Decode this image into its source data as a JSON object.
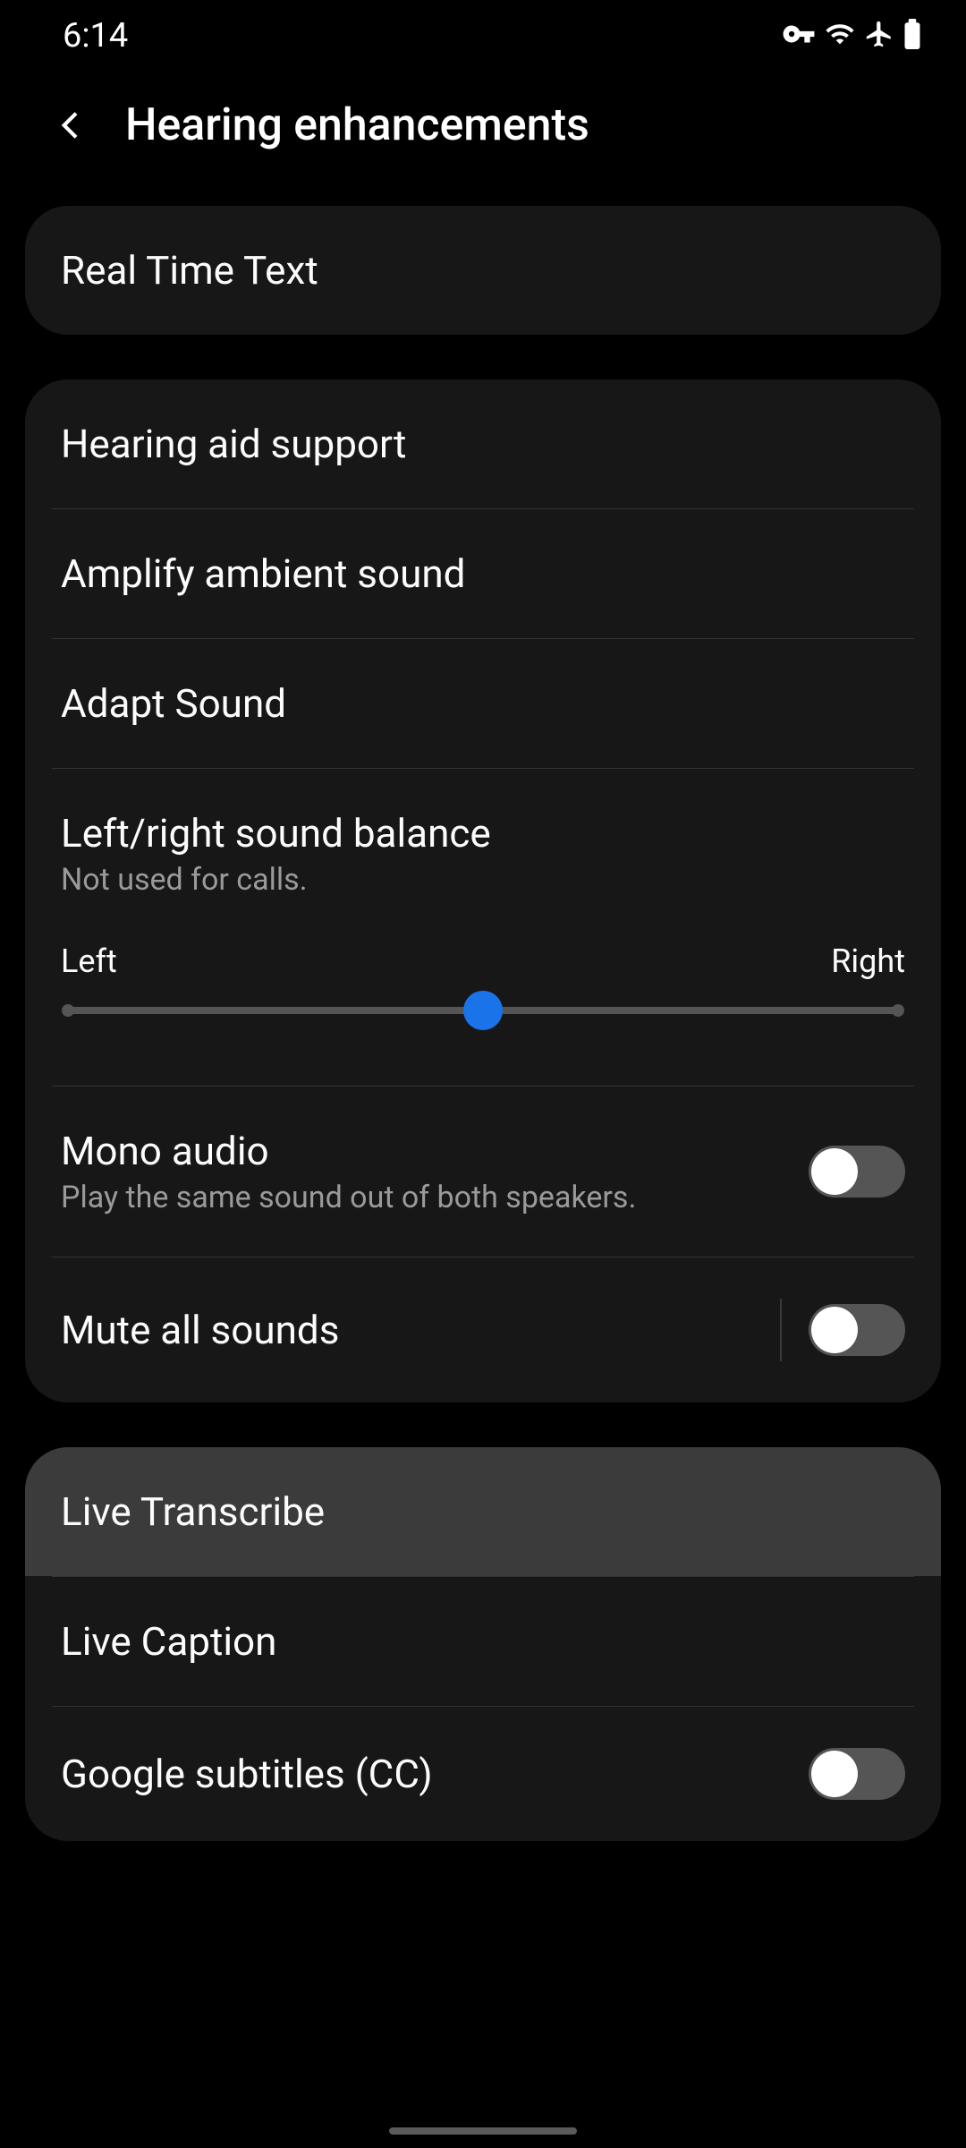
{
  "status": {
    "time": "6:14"
  },
  "header": {
    "title": "Hearing enhancements"
  },
  "card1": {
    "rtt": "Real Time Text"
  },
  "card2": {
    "hearing_aid": "Hearing aid support",
    "amplify": "Amplify ambient sound",
    "adapt": "Adapt Sound",
    "balance_title": "Left/right sound balance",
    "balance_sub": "Not used for calls.",
    "balance_left": "Left",
    "balance_right": "Right",
    "balance_value": 50,
    "mono_title": "Mono audio",
    "mono_sub": "Play the same sound out of both speakers.",
    "mono_on": false,
    "mute_title": "Mute all sounds",
    "mute_on": false
  },
  "card3": {
    "live_transcribe": "Live Transcribe",
    "live_caption": "Live Caption",
    "google_subtitles": "Google subtitles (CC)",
    "subtitles_on": false
  }
}
